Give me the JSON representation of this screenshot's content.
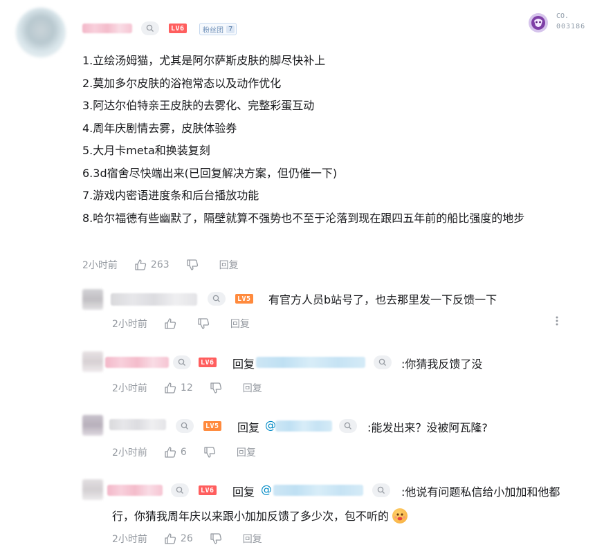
{
  "top_comment": {
    "level": "LV6",
    "fans_badge": {
      "label": "粉丝团",
      "count": "7"
    },
    "decoration_number": {
      "prefix": "CO.",
      "number": "003186"
    },
    "lines": [
      "1.立绘汤姆猫，尤其是阿尔萨斯皮肤的脚尽快补上",
      "2.莫加多尔皮肤的浴袍常态以及动作优化",
      "3.阿达尔伯特亲王皮肤的去雾化、完整彩蛋互动",
      "4.周年庆剧情去雾，皮肤体验券",
      "5.大月卡meta和换装复刻",
      "6.3d宿舍尽快端出来(已回复解决方案，但仍催一下)",
      "7.游戏内密语进度条和后台播放功能",
      "8.哈尔福德有些幽默了，隔壁就算不强势也不至于沦落到现在跟四五年前的船比强度的地步"
    ],
    "time": "2小时前",
    "likes": "263",
    "reply_label": "回复"
  },
  "replies": [
    {
      "level": "LV5",
      "reply_prefix": "",
      "mention": "",
      "text": "有官方人员b站号了，也去那里发一下反馈一下",
      "time": "2小时前",
      "likes": "",
      "reply_label": "回复"
    },
    {
      "level": "LV6",
      "reply_prefix": "回复",
      "mention": "",
      "text": ":你猜我反馈了没",
      "time": "2小时前",
      "likes": "12",
      "reply_label": "回复"
    },
    {
      "level": "LV5",
      "reply_prefix": "回复",
      "mention": "@",
      "text": ":能发出来？没被阿瓦隆?",
      "time": "2小时前",
      "likes": "6",
      "reply_label": "回复"
    },
    {
      "level": "LV6",
      "reply_prefix": "回复",
      "mention": "@",
      "text_line1": ":他说有问题私信给小加加和他都",
      "text_line2": "行，你猜我周年庆以来跟小加加反馈了多少次，包不听的",
      "time": "2小时前",
      "likes": "26",
      "reply_label": "回复"
    }
  ],
  "icons": {
    "search": "search-icon",
    "like": "thumbs-up-icon",
    "dislike": "thumbs-down-icon",
    "more": "more-vertical-icon",
    "emoji": "emoji-icon"
  },
  "colors": {
    "level6": "#ff5e5e",
    "level5": "#ff8a3d",
    "meta_text": "#9499a0",
    "mention": "#008ac5"
  }
}
